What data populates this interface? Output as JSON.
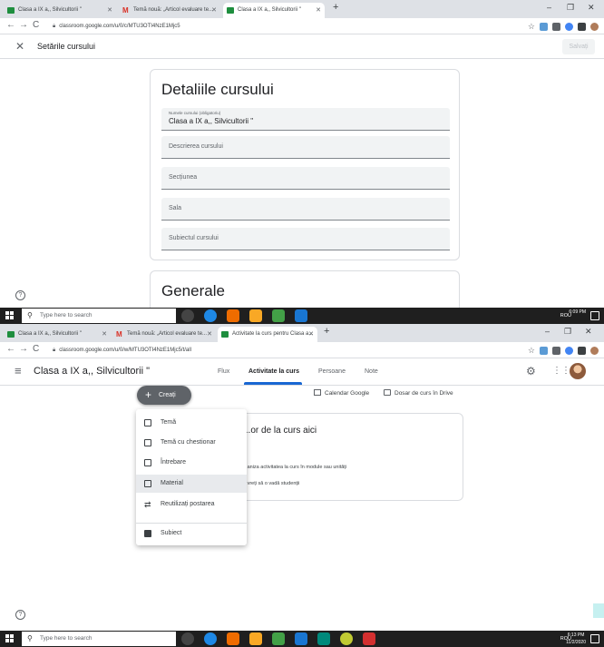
{
  "browser_top": {
    "tabs": [
      {
        "label": "Clasa a IX a,, Silvicultorii \"",
        "icon": "classroom-icon",
        "active": false
      },
      {
        "label": "Temă nouă: „Articol evaluare te...",
        "icon": "gmail-icon",
        "active": false
      },
      {
        "label": "Clasa a IX a,, Silvicultorii \"",
        "icon": "classroom-icon",
        "active": true
      }
    ],
    "url": "classroom.google.com/u/0/c/MTU3OTI4NzE1Mjc5"
  },
  "settings": {
    "close_icon": "close-icon",
    "title": "Setările cursului",
    "save_label": "Salvați",
    "details_title": "Detaliile cursului",
    "course_name_label": "Numele cursului (obligatoriu)",
    "course_name_value": "Clasa a IX a,, Silvicultorii \"",
    "description_label": "Descrierea cursului",
    "section_label": "Secțiunea",
    "room_label": "Sala",
    "subject_label": "Subiectul cursului",
    "general_title": "Generale"
  },
  "taskbar_top": {
    "search_placeholder": "Type here to search",
    "tray": "ROU",
    "time": "6:09 PM",
    "date": ""
  },
  "browser_bottom": {
    "tabs": [
      {
        "label": "Clasa a IX a,, Silvicultorii \"",
        "icon": "classroom-icon",
        "active": false
      },
      {
        "label": "Temă nouă: „Articol evaluare te...",
        "icon": "gmail-icon",
        "active": false
      },
      {
        "label": "Activitate la curs pentru Clasa a...",
        "icon": "classroom-icon",
        "active": true
      }
    ],
    "url": "classroom.google.com/u/0/w/MTU3OTI4NzE1Mjc5/t/all"
  },
  "classroom": {
    "class_title": "Clasa a IX a,, Silvicultorii \"",
    "tabs": [
      "Flux",
      "Activitate la curs",
      "Persoane",
      "Note"
    ],
    "active_tab": "Activitate la curs",
    "create_label": "Creați",
    "calendar_link": "Calendar Google",
    "drive_link": "Dosar de curs în Drive",
    "card_heading": "...or de la curs aici",
    "card_line1": "...aniza activitatea la curs în module sau unități",
    "card_line2": "...vreți să o vadă studenții",
    "menu": [
      {
        "label": "Temă",
        "icon": "assignment-icon"
      },
      {
        "label": "Temă cu chestionar",
        "icon": "quiz-assignment-icon"
      },
      {
        "label": "Întrebare",
        "icon": "question-icon"
      },
      {
        "label": "Material",
        "icon": "material-icon",
        "hovered": true
      },
      {
        "label": "Reutilizați postarea",
        "icon": "reuse-icon"
      },
      {
        "label": "Subiect",
        "icon": "topic-icon"
      }
    ]
  },
  "taskbar_bottom": {
    "search_placeholder": "Type here to search",
    "tray": "ROU",
    "time": "6:13 PM",
    "date": "11/2/2020"
  }
}
